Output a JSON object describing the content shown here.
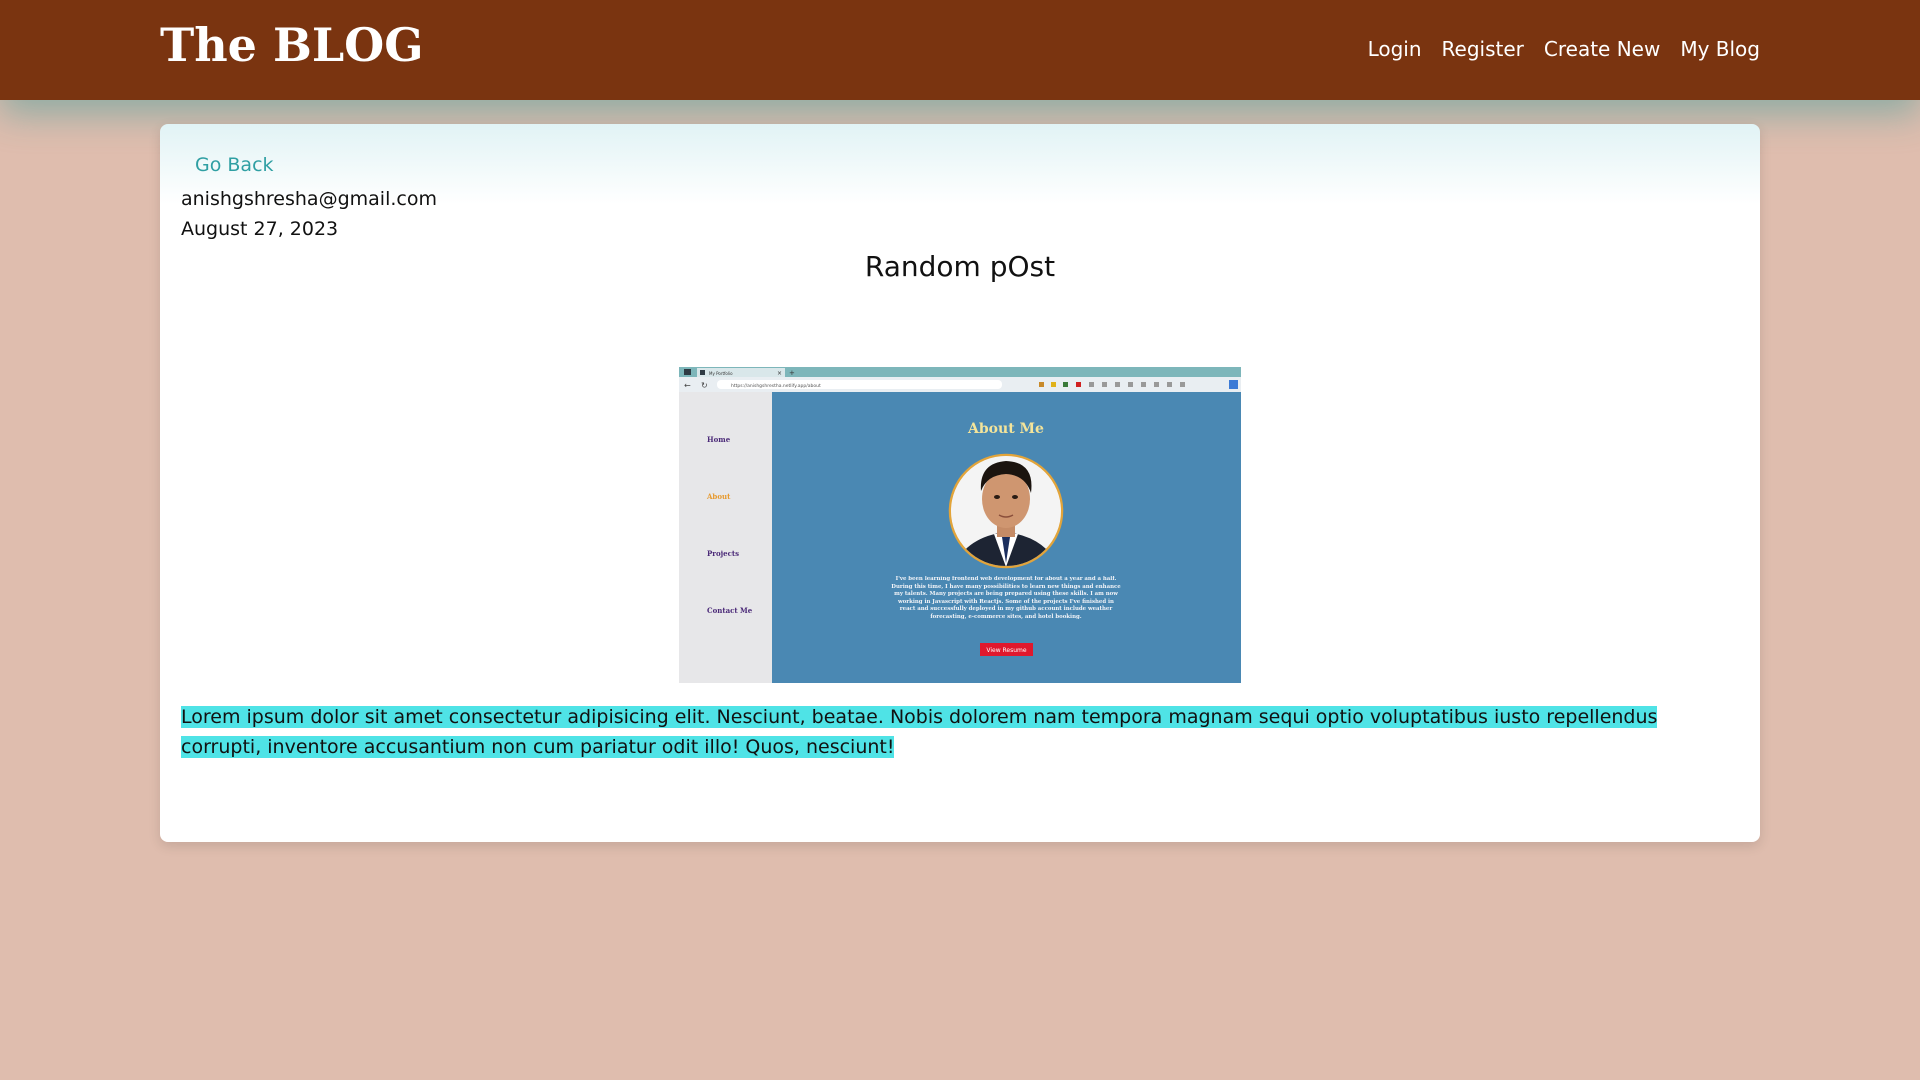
{
  "brand": "The BLOG",
  "nav": {
    "login": "Login",
    "register": "Register",
    "create_new": "Create New",
    "my_blog": "My Blog"
  },
  "post": {
    "back_label": "Go Back",
    "author": "anishgshresha@gmail.com",
    "date": "August 27, 2023",
    "title": "Random pOst",
    "body": " Lorem ipsum dolor sit amet consectetur adipisicing elit. Nesciunt, beatae. Nobis dolorem nam tempora magnam sequi optio voluptatibus iusto repellendus corrupti, inventore accusantium non cum pariatur odit illo! Quos, nesciunt!"
  },
  "screenshot": {
    "tab_title": "My Portfolio",
    "url": "https://anishgshrestha.netlify.app/about",
    "sidebar": [
      "Home",
      "About",
      "Projects",
      "Contact Me"
    ],
    "heading": "About Me",
    "paragraph": "I've been learning frontend web development for about a year and a half. During this time, I have many possibilities to learn new things and enhance my talents. Many projects are being prepared using these skills. I am now working in Javascript with Reactjs. Some of the projects I've finished in react and successfully deployed in my github account include weather forecasting, e-commerce sites, and hotel booking.",
    "button": "View Resume"
  },
  "colors": {
    "navbar": "#7a3410",
    "page_bg": "#dfbdae",
    "link": "#2f9fa3",
    "highlight": "#4fe3e6",
    "screenshot_main": "#4a88b3",
    "screenshot_button": "#e0182d"
  }
}
